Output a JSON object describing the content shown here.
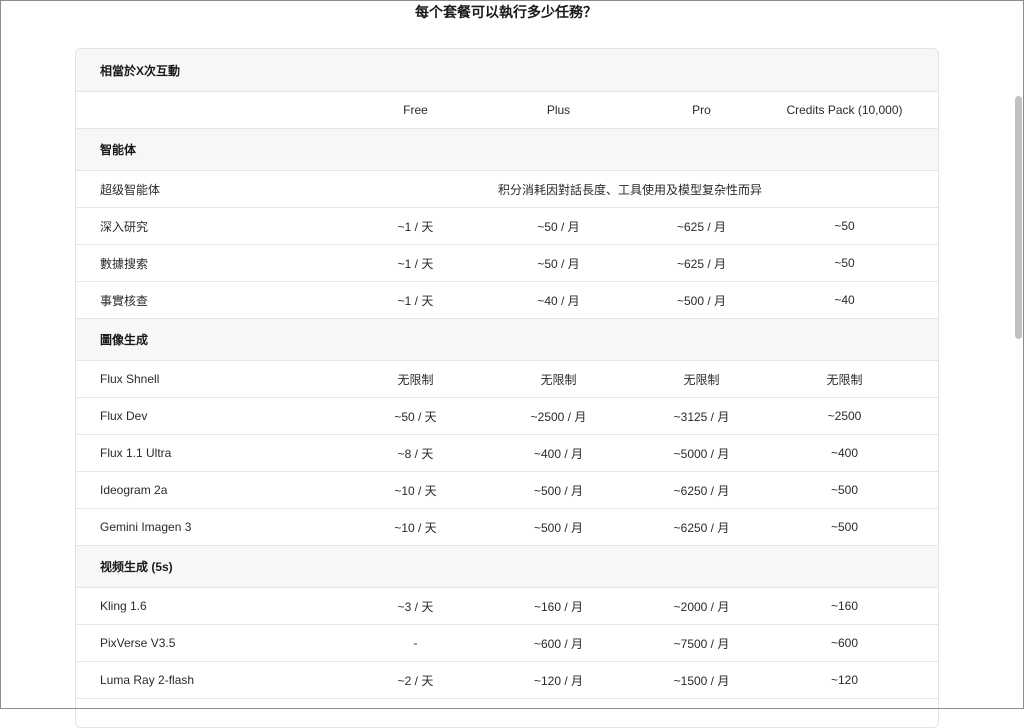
{
  "page": {
    "title": "每个套餐可以執行多少任務？"
  },
  "table": {
    "top_label": "相當於X次互動",
    "columns": [
      "Free",
      "Plus",
      "Pro",
      "Credits Pack (10,000)"
    ],
    "sections": [
      {
        "title": "智能体",
        "rows": [
          {
            "label": "超级智能体",
            "merged": "积分消耗因對話長度、工具使用及模型复杂性而异"
          },
          {
            "label": "深入研究",
            "values": [
              "~1 / 天",
              "~50 / 月",
              "~625 / 月",
              "~50"
            ]
          },
          {
            "label": "數據搜索",
            "values": [
              "~1 / 天",
              "~50 / 月",
              "~625 / 月",
              "~50"
            ]
          },
          {
            "label": "事實核查",
            "values": [
              "~1 / 天",
              "~40 / 月",
              "~500 / 月",
              "~40"
            ]
          }
        ]
      },
      {
        "title": "圖像生成",
        "rows": [
          {
            "label": "Flux Shnell",
            "values": [
              "无限制",
              "无限制",
              "无限制",
              "无限制"
            ]
          },
          {
            "label": "Flux Dev",
            "values": [
              "~50 / 天",
              "~2500 / 月",
              "~3125 / 月",
              "~2500"
            ]
          },
          {
            "label": "Flux 1.1 Ultra",
            "values": [
              "~8 / 天",
              "~400 / 月",
              "~5000 / 月",
              "~400"
            ]
          },
          {
            "label": "Ideogram 2a",
            "values": [
              "~10 / 天",
              "~500 / 月",
              "~6250 / 月",
              "~500"
            ]
          },
          {
            "label": "Gemini Imagen 3",
            "values": [
              "~10 / 天",
              "~500 / 月",
              "~6250 / 月",
              "~500"
            ]
          }
        ]
      },
      {
        "title": "视频生成 (5s)",
        "rows": [
          {
            "label": "Kling 1.6",
            "values": [
              "~3 / 天",
              "~160 / 月",
              "~2000 / 月",
              "~160"
            ]
          },
          {
            "label": "PixVerse V3.5",
            "values": [
              "-",
              "~600 / 月",
              "~7500 / 月",
              "~600"
            ]
          },
          {
            "label": "Luma Ray 2-flash",
            "values": [
              "~2 / 天",
              "~120 / 月",
              "~1500 / 月",
              "~120"
            ]
          }
        ]
      }
    ]
  }
}
